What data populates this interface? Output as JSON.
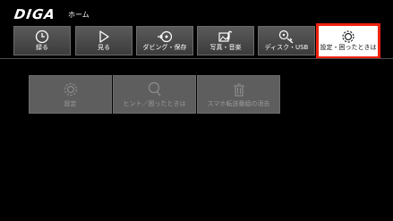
{
  "header": {
    "logo": "DIGA",
    "page": "ホーム"
  },
  "tabs": [
    {
      "label": "録る",
      "icon": "clock-icon"
    },
    {
      "label": "見る",
      "icon": "play-icon"
    },
    {
      "label": "ダビング・保存",
      "icon": "dubbing-disc-icon"
    },
    {
      "label": "写真・音楽",
      "icon": "photo-music-icon"
    },
    {
      "label": "ディスク・USB",
      "icon": "disc-usb-icon"
    },
    {
      "label": "設定・困ったときは",
      "icon": "gear-icon",
      "selected": true
    }
  ],
  "submenu": [
    {
      "label": "設定",
      "icon": "gear-icon"
    },
    {
      "label": "ヒント／困ったときは",
      "icon": "magnifier-hint-icon"
    },
    {
      "label": "スマホ転送番組の消去",
      "icon": "trash-icon"
    }
  ],
  "colors": {
    "selection_border": "#e21111",
    "background": "#000000",
    "disabled_text": "#9a9a9a"
  }
}
